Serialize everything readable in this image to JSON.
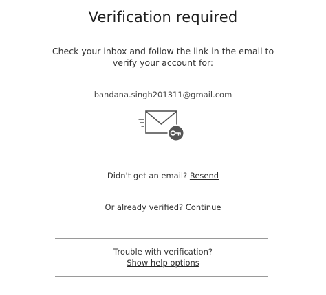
{
  "page": {
    "title": "Verification required",
    "instructions": "Check your inbox and follow the link in the email to verify your account for:",
    "email": "bandana.singh201311@gmail.com"
  },
  "illustration": {
    "icon": "envelope-with-key-icon",
    "stroke_color": "#555555"
  },
  "resend": {
    "prompt": "Didn't get an email? ",
    "link_label": "Resend"
  },
  "continue": {
    "prompt": "Or already verified? ",
    "link_label": "Continue"
  },
  "help": {
    "prompt": "Trouble with verification?",
    "link_label": "Show help options"
  },
  "colors": {
    "text": "#2b2b2b",
    "divider": "#9a9a9a"
  }
}
